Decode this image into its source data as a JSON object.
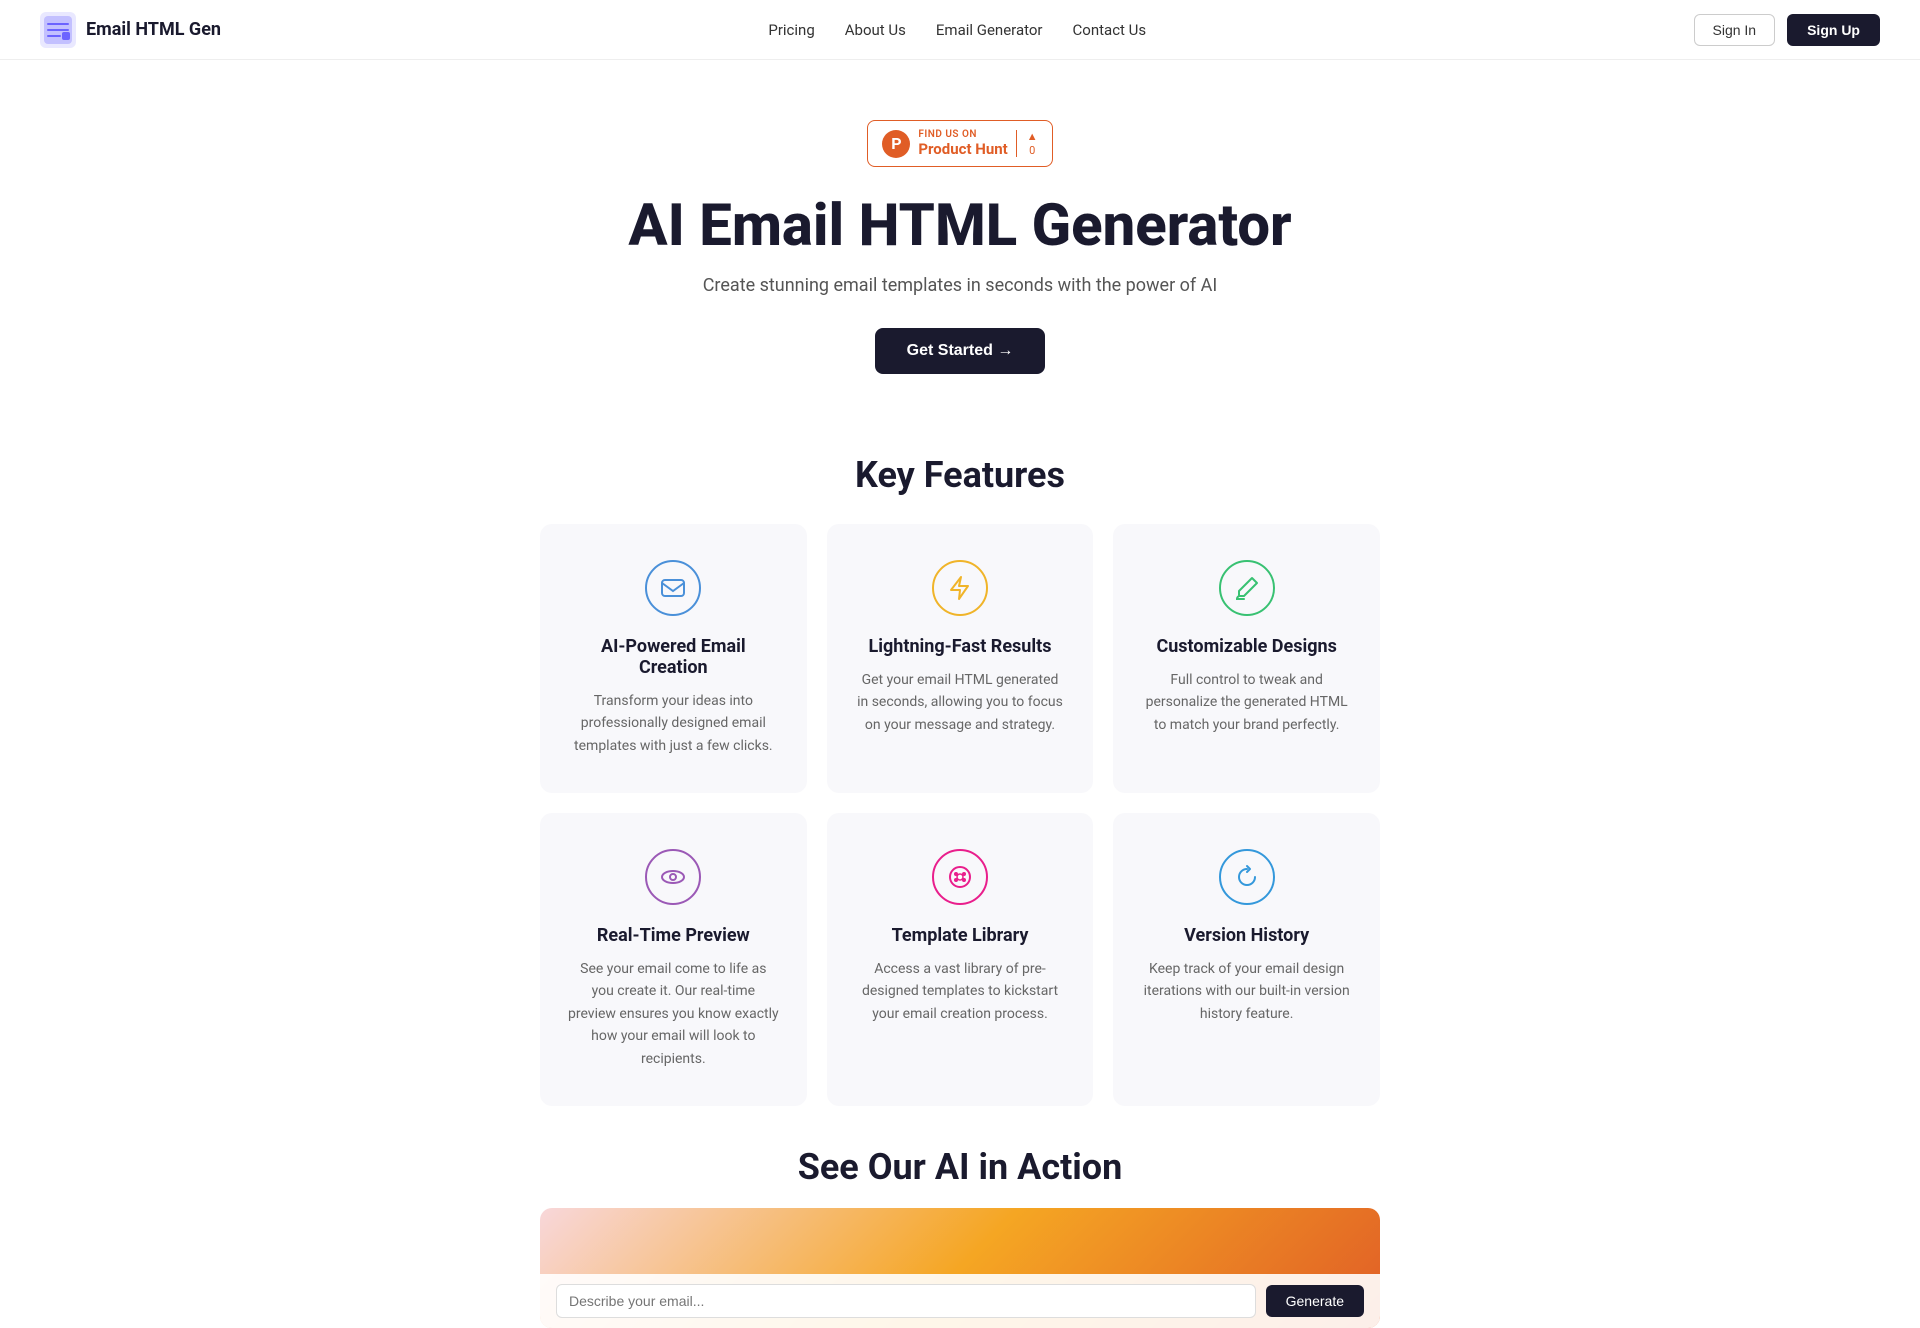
{
  "nav": {
    "logo_text": "Email HTML Gen",
    "links": [
      {
        "label": "Pricing",
        "href": "#"
      },
      {
        "label": "About Us",
        "href": "#"
      },
      {
        "label": "Email Generator",
        "href": "#"
      },
      {
        "label": "Contact Us",
        "href": "#"
      }
    ],
    "signin_label": "Sign In",
    "signup_label": "Sign Up"
  },
  "product_hunt": {
    "find_us": "FIND US ON",
    "name": "Product Hunt",
    "upvote_arrow": "▲",
    "upvote_count": "0"
  },
  "hero": {
    "title": "AI Email HTML Generator",
    "subtitle": "Create stunning email templates in seconds with the power of AI",
    "cta_label": "Get Started →"
  },
  "features_section": {
    "title": "Key Features",
    "cards": [
      {
        "icon": "✉",
        "icon_style": "blue",
        "title": "AI-Powered Email Creation",
        "description": "Transform your ideas into professionally designed email templates with just a few clicks."
      },
      {
        "icon": "⚡",
        "icon_style": "yellow",
        "title": "Lightning-Fast Results",
        "description": "Get your email HTML generated in seconds, allowing you to focus on your message and strategy."
      },
      {
        "icon": "✏",
        "icon_style": "green",
        "title": "Customizable Designs",
        "description": "Full control to tweak and personalize the generated HTML to match your brand perfectly."
      },
      {
        "icon": "👁",
        "icon_style": "purple",
        "title": "Real-Time Preview",
        "description": "See your email come to life as you create it. Our real-time preview ensures you know exactly how your email will look to recipients."
      },
      {
        "icon": "🎨",
        "icon_style": "pink",
        "title": "Template Library",
        "description": "Access a vast library of pre-designed templates to kickstart your email creation process."
      },
      {
        "icon": "↻",
        "icon_style": "blue2",
        "title": "Version History",
        "description": "Keep track of your email design iterations with our built-in version history feature."
      }
    ]
  },
  "action_section": {
    "title": "See Our AI in Action"
  }
}
